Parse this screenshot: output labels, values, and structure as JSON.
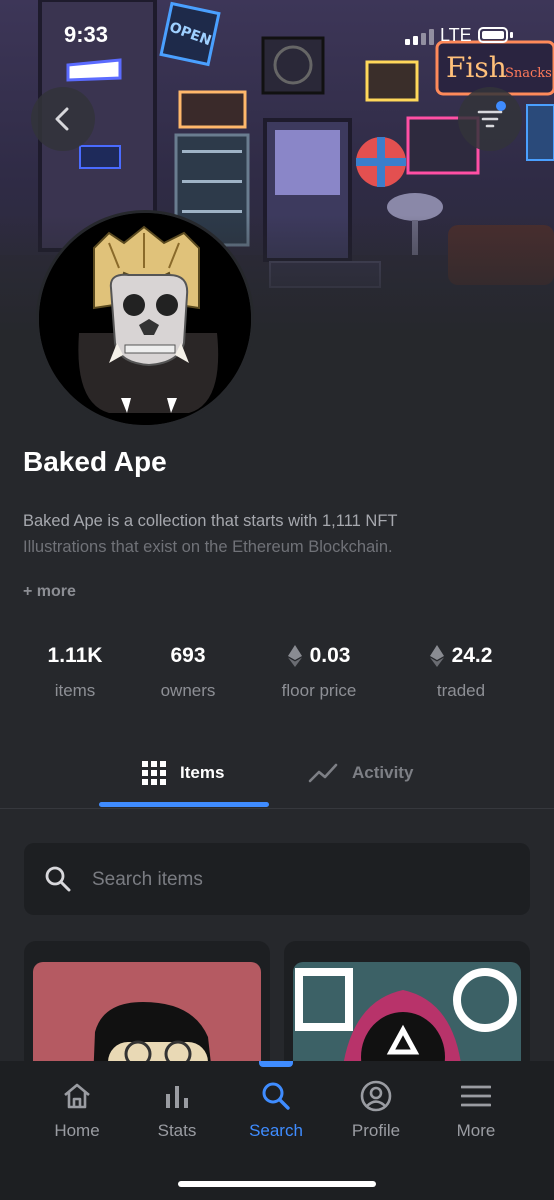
{
  "status_bar": {
    "time": "9:33",
    "network": "LTE"
  },
  "banner_signs": {
    "open": "OPEN",
    "fish": "Fish",
    "snacks": "Snacks"
  },
  "collection": {
    "name": "Baked Ape",
    "description_line1": "Baked Ape is a collection that starts with 1,111 NFT",
    "description_line2": "Illustrations that exist on the Ethereum Blockchain.",
    "more_label": "+ more"
  },
  "stats": [
    {
      "value": "1.11K",
      "label": "items",
      "eth_icon": false
    },
    {
      "value": "693",
      "label": "owners",
      "eth_icon": false
    },
    {
      "value": "0.03",
      "label": "floor price",
      "eth_icon": true
    },
    {
      "value": "24.2",
      "label": "traded",
      "eth_icon": true
    }
  ],
  "tabs": [
    {
      "label": "Items",
      "icon": "grid-icon",
      "active": true
    },
    {
      "label": "Activity",
      "icon": "activity-chart-icon",
      "active": false
    }
  ],
  "search": {
    "placeholder": "Search items"
  },
  "bottom_nav": [
    {
      "label": "Home",
      "icon": "home-icon",
      "active": false
    },
    {
      "label": "Stats",
      "icon": "stats-icon",
      "active": false
    },
    {
      "label": "Search",
      "icon": "search-icon",
      "active": true
    },
    {
      "label": "Profile",
      "icon": "profile-icon",
      "active": false
    },
    {
      "label": "More",
      "icon": "menu-icon",
      "active": false
    }
  ],
  "colors": {
    "accent": "#3f8cff",
    "background": "#26282c",
    "surface": "#1d1f22"
  }
}
